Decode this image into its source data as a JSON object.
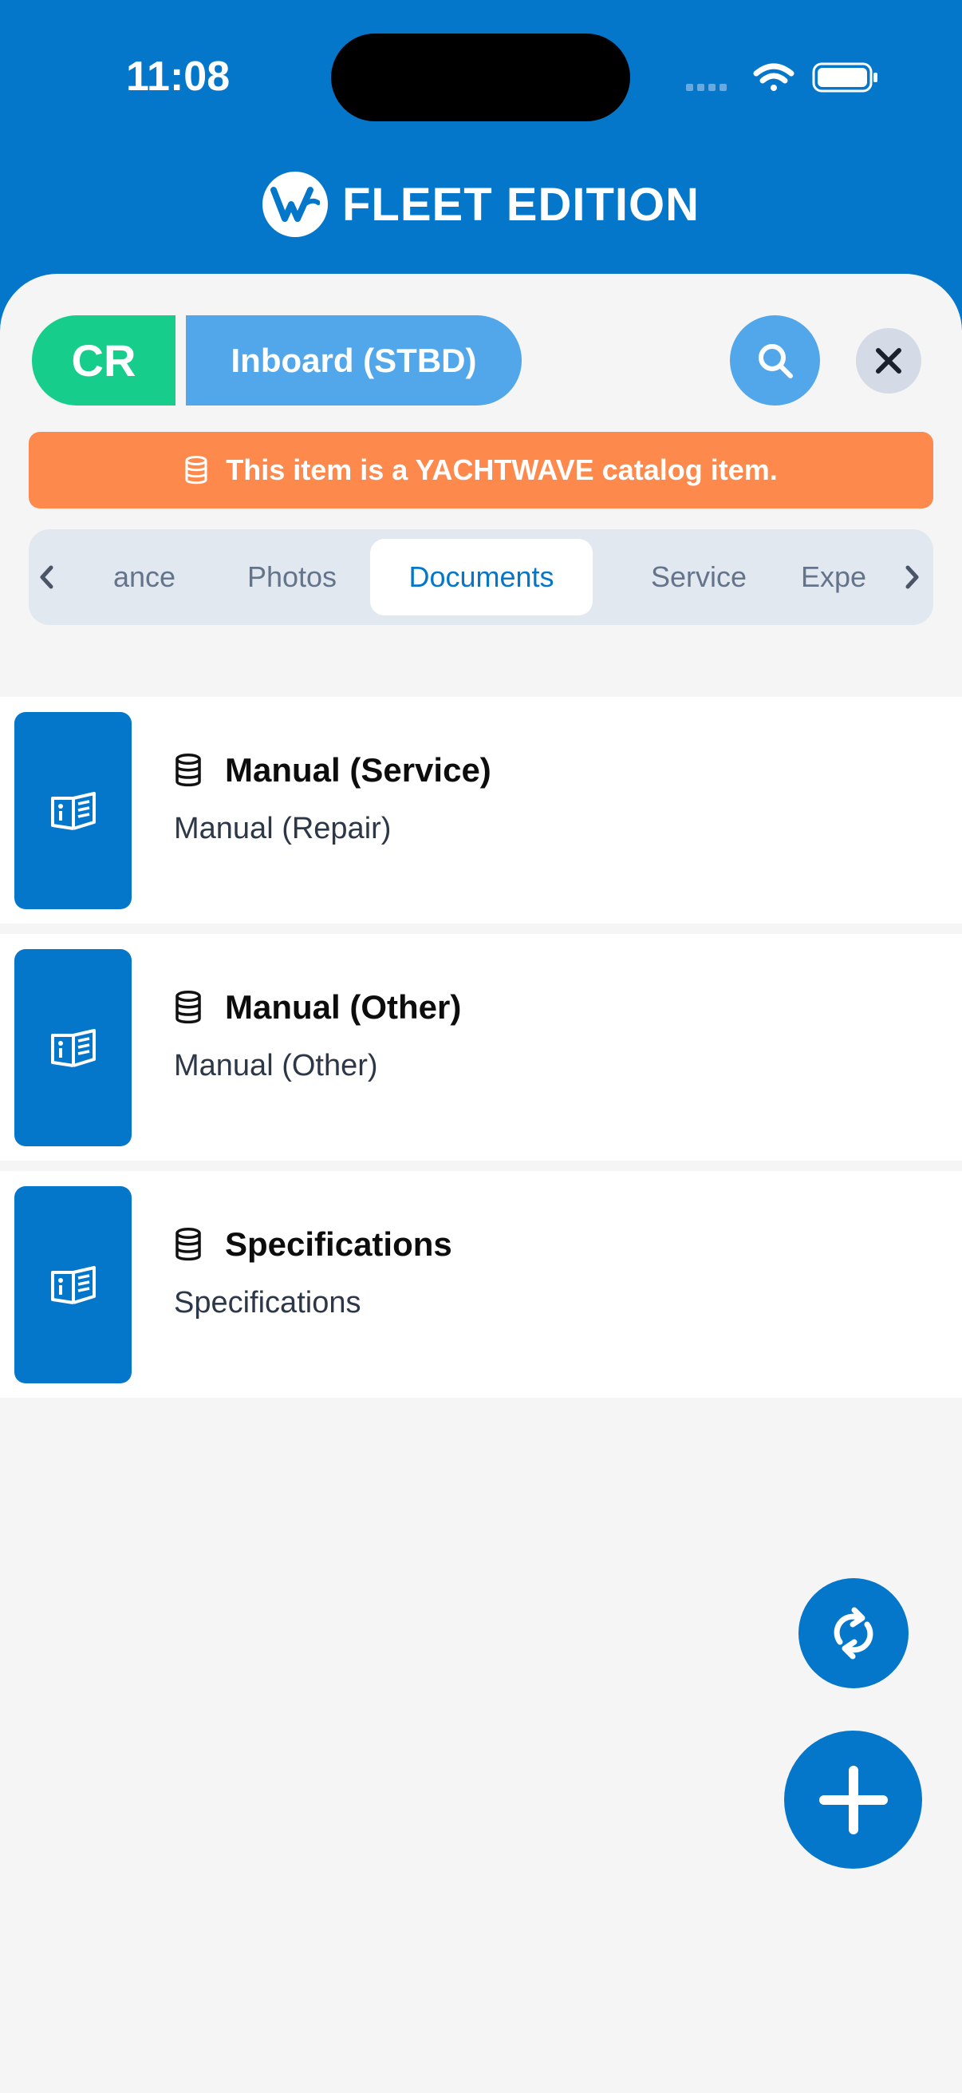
{
  "status_bar": {
    "time": "11:08"
  },
  "header": {
    "brand": "FLEET EDITION"
  },
  "item": {
    "code": "CR",
    "name": "Inboard (STBD)"
  },
  "catalog_banner": {
    "text": "This item is a YACHTWAVE catalog item."
  },
  "tabs": {
    "items": [
      {
        "label": "ance"
      },
      {
        "label": "Photos"
      },
      {
        "label": "Documents",
        "active": true
      },
      {
        "label": "Service"
      },
      {
        "label": "Expe"
      }
    ]
  },
  "documents": [
    {
      "title": "Manual (Service)",
      "subtitle": "Manual (Repair)"
    },
    {
      "title": "Manual (Other)",
      "subtitle": "Manual (Other)"
    },
    {
      "title": "Specifications",
      "subtitle": "Specifications"
    }
  ],
  "colors": {
    "brand_blue": "#0577cb",
    "code_green": "#16cd8c",
    "name_blue": "#52a7ea",
    "banner_orange": "#fd894c"
  },
  "icons": {
    "search": "search-icon",
    "close": "close-icon",
    "catalog": "database-icon",
    "document": "manual-book-icon",
    "sync": "sync-icon",
    "add": "plus-icon"
  }
}
